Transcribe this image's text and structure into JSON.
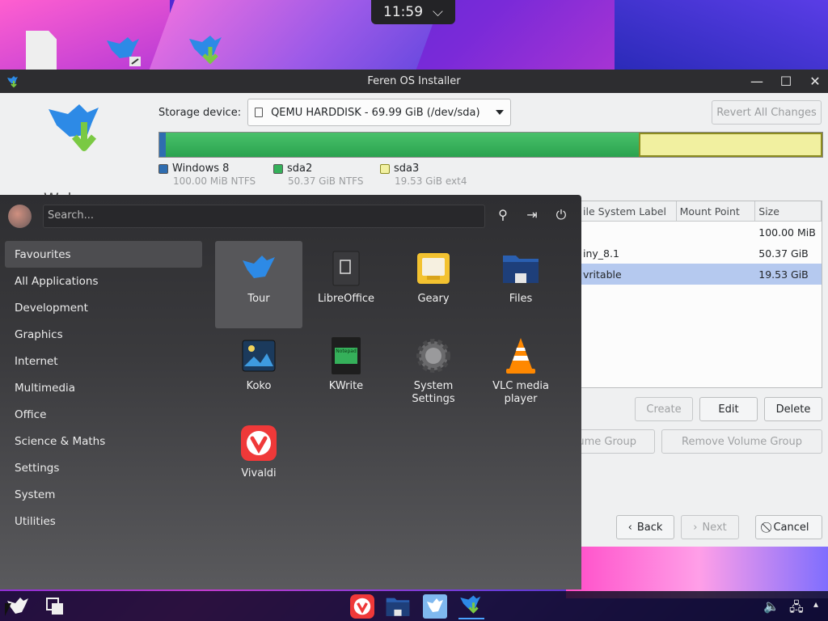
{
  "clock": {
    "time": "11:59",
    "chevron": "⌵"
  },
  "installer": {
    "title": "Feren OS Installer",
    "controls": {
      "minimize": "—",
      "maximize": "☐",
      "close": "✕"
    },
    "welcome": "Welcome",
    "storage_label": "Storage device:",
    "storage_value": "QEMU HARDDISK - 69.99 GiB (/dev/sda)",
    "revert": "Revert All Changes",
    "partition_bar": {
      "windows8_fraction": 0.001,
      "sda2_fraction": 0.72,
      "sda3_fraction": 0.28
    },
    "legend": [
      {
        "name": "Windows 8",
        "detail": "100.00 MiB  NTFS",
        "color": "#2f6db0"
      },
      {
        "name": "sda2",
        "detail": "50.37 GiB  NTFS",
        "color": "#35b05a"
      },
      {
        "name": "sda3",
        "detail": "19.53 GiB  ext4",
        "color": "#f1f0a0"
      }
    ],
    "table": {
      "headers": [
        "ile System Label",
        "Mount Point",
        "Size"
      ],
      "rows": [
        {
          "label": "",
          "mount": "",
          "size": "100.00 MiB"
        },
        {
          "label": "iny_8.1",
          "mount": "",
          "size": "50.37 GiB"
        },
        {
          "label": "vritable",
          "mount": "",
          "size": "19.53 GiB"
        }
      ]
    },
    "buttons": {
      "create": "Create",
      "edit": "Edit",
      "delete": "Delete",
      "volume_group": "ume Group",
      "remove_volume_group": "Remove Volume Group",
      "back": "Back",
      "next": "Next",
      "cancel": "Cancel"
    }
  },
  "menu": {
    "search_placeholder": "Search...",
    "categories": [
      "Favourites",
      "All Applications",
      "Development",
      "Graphics",
      "Internet",
      "Multimedia",
      "Office",
      "Science & Maths",
      "Settings",
      "System",
      "Utilities"
    ],
    "apps": [
      {
        "name": "Tour",
        "icon": "feren-bird-icon"
      },
      {
        "name": "LibreOffice",
        "icon": "libreoffice-icon"
      },
      {
        "name": "Geary",
        "icon": "geary-mail-icon"
      },
      {
        "name": "Files",
        "icon": "files-folder-icon"
      },
      {
        "name": "Koko",
        "icon": "koko-photo-icon"
      },
      {
        "name": "KWrite",
        "icon": "kwrite-notepad-icon"
      },
      {
        "name": "System Settings",
        "icon": "settings-gear-icon"
      },
      {
        "name": "VLC media player",
        "icon": "vlc-cone-icon"
      },
      {
        "name": "Vivaldi",
        "icon": "vivaldi-icon"
      }
    ],
    "kwrite_text": "Notepad"
  },
  "colors": {
    "accent_blue": "#2d8ae6",
    "menu_bg": "#2e2e31",
    "selection": "#b5c9ef",
    "vivaldi_red": "#ef3939",
    "vlc_orange": "#ff8800"
  }
}
